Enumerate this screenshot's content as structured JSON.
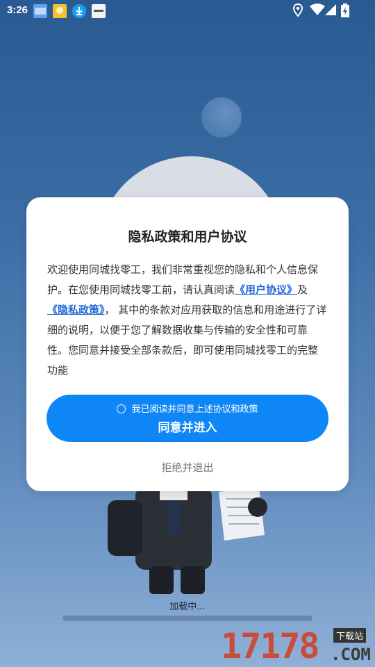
{
  "status_bar": {
    "time": "3:26",
    "notification_icons": [
      "app-icon",
      "app-icon",
      "download-icon",
      "app-icon"
    ],
    "right_icons": [
      "location-icon",
      "wifi-icon",
      "signal-icon",
      "battery-charging-icon"
    ]
  },
  "dialog": {
    "title": "隐私政策和用户协议",
    "body_part1": "欢迎使用同城找零工，我们非常重视您的隐私和个人信息保护。在您使用同城找零工前，请认真阅读",
    "user_agreement_link": "《用户协议》",
    "and_text": "及",
    "privacy_policy_link": "《隐私政策》",
    "body_part2": "， 其中的条款对应用获取的信息和用途进行了详细的说明，以便于您了解数据收集与传输的安全性和可靠性。您同意并接受全部条款后，即可使用同城找零工的完整功能",
    "agree_checkbox_label": "我已阅读并同意上述协议和政策",
    "agree_button_label": "同意并进入",
    "decline_button_label": "拒绝并退出"
  },
  "loading": {
    "text": "加载中..."
  },
  "watermark": {
    "number": "17178",
    "tag": "下载站",
    "suffix": ".COM"
  },
  "colors": {
    "primary_button": "#0e86f5",
    "link": "#1e64d6",
    "background_top": "#2a5a92"
  }
}
